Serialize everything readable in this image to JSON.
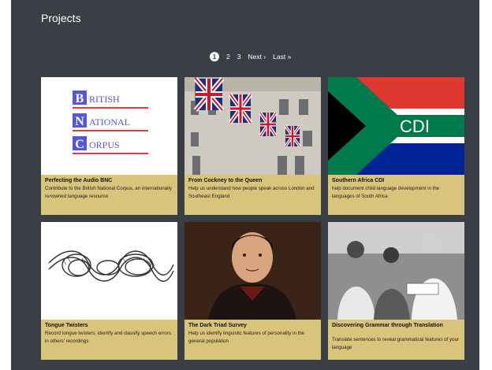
{
  "page": {
    "title": "Projects"
  },
  "pagination": {
    "current": "1",
    "pages": [
      "2",
      "3"
    ],
    "next": "Next ›",
    "last": "Last »"
  },
  "cards": [
    {
      "title": "Perfecting the Audio BNC",
      "description": "Contribute to the British National Corpus, an internationally renowned language resource",
      "logo": {
        "b": "B",
        "b_rest": "RITISH",
        "n": "N",
        "n_rest": "ATIONAL",
        "c": "C",
        "c_rest": "ORPUS"
      }
    },
    {
      "title": "From Cockney to the Queen",
      "description": "Help us understand how people speak across London and Southeast England"
    },
    {
      "title": "Southern Africa CDI",
      "description": "help document child language development in the languages of South Africa",
      "flag_text": "CDI"
    },
    {
      "title": "Tongue Twisters",
      "description": "Record tongue twisters; identify and classify speech errors in others' recordings"
    },
    {
      "title": "The Dark Triad Survey",
      "description": "Help us identify linguistic features of personality in the general population"
    },
    {
      "title": "Discovering Grammar through Translation",
      "description": "Translate sentences to reveal grammatical features of your language"
    }
  ],
  "colors": {
    "background": "#3a3e45",
    "card": "#d9c47b",
    "logo_blue": "#5557d8",
    "logo_red": "#e03c3c"
  }
}
